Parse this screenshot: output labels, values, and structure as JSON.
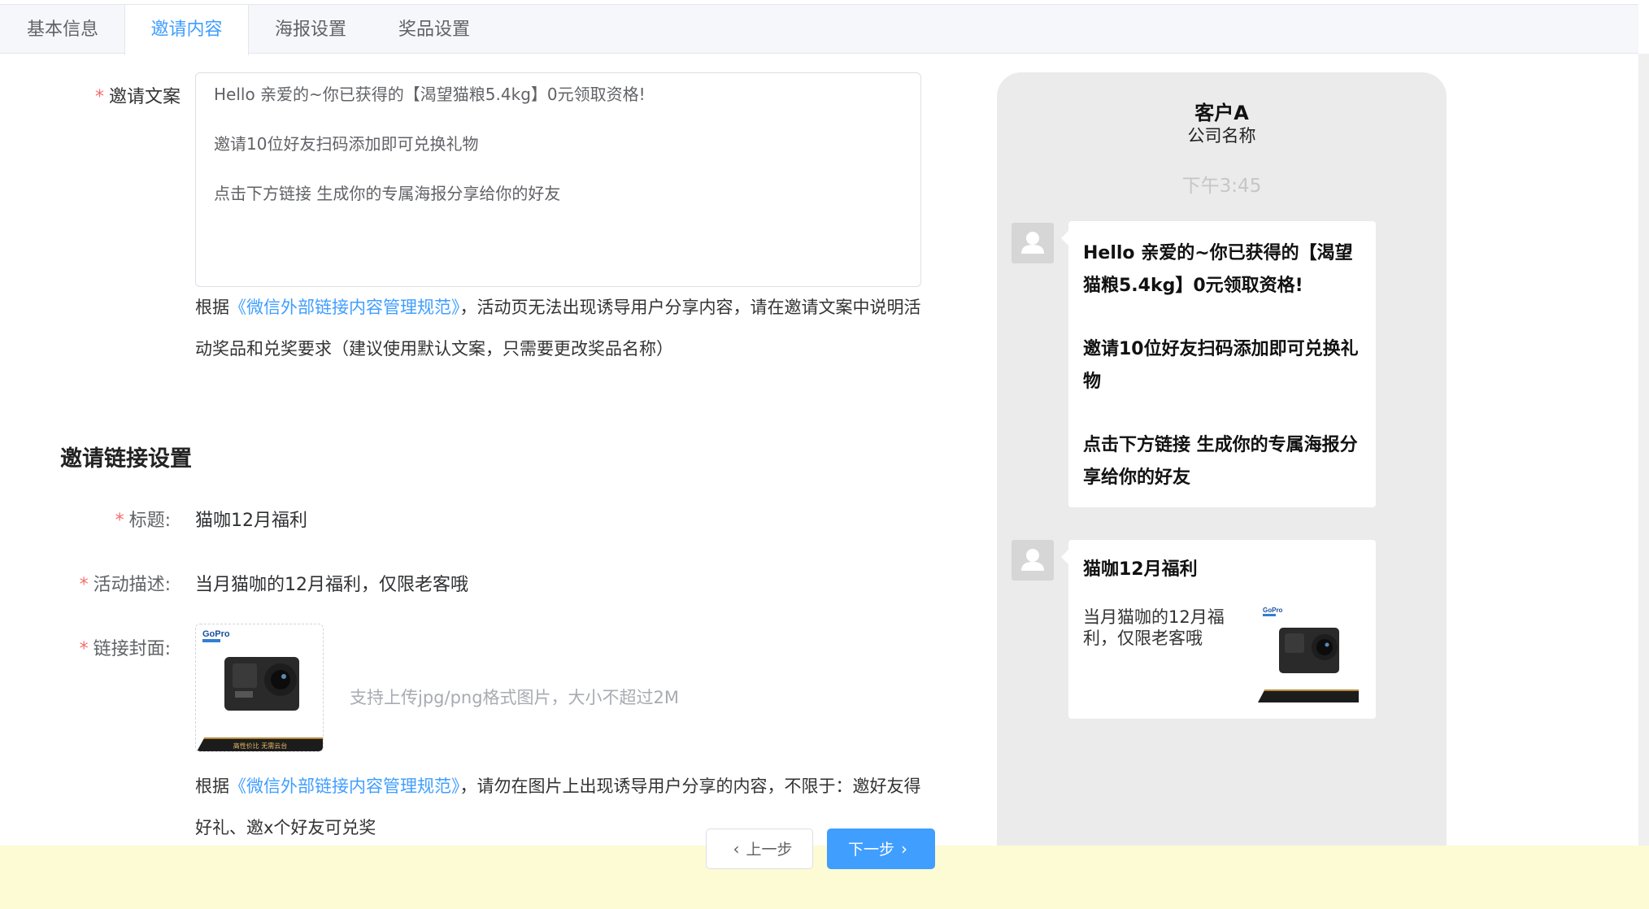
{
  "tabs": [
    {
      "label": "基本信息",
      "active": false
    },
    {
      "label": "邀请内容",
      "active": true
    },
    {
      "label": "海报设置",
      "active": false
    },
    {
      "label": "奖品设置",
      "active": false
    }
  ],
  "invite_text": {
    "label": "邀请文案",
    "lines": [
      "Hello 亲爱的~你已获得的【渴望猫粮5.4kg】0元领取资格!",
      "邀请10位好友扫码添加即可兑换礼物",
      "点击下方链接 生成你的专属海报分享给你的好友"
    ],
    "help_prefix": "根据",
    "help_link": "《微信外部链接内容管理规范》",
    "help_suffix": "，活动页无法出现诱导用户分享内容，请在邀请文案中说明活动奖品和兑奖要求（建议使用默认文案，只需要更改奖品名称）"
  },
  "link_settings": {
    "section_title": "邀请链接设置",
    "title_label": "标题:",
    "title_value": "猫咖12月福利",
    "desc_label": "活动描述:",
    "desc_value": "当月猫咖的12月福利，仅限老客哦",
    "cover_label": "链接封面:",
    "upload_tip": "支持上传jpg/png格式图片，大小不超过2M",
    "cover_brand": "GoPro",
    "cover_ribbon": "高性价比 无需云台",
    "help_prefix": "根据",
    "help_link": "《微信外部链接内容管理规范》",
    "help_suffix": "，请勿在图片上出现诱导用户分享的内容，不限于：邀好友得好礼、邀x个好友可兑奖"
  },
  "preview": {
    "customer_name": "客户A",
    "company": "公司名称",
    "time": "下午3:45",
    "message_lines": [
      "Hello 亲爱的~你已获得的【渴望猫粮5.4kg】0元领取资格!",
      "邀请10位好友扫码添加即可兑换礼物",
      "点击下方链接 生成你的专属海报分享给你的好友"
    ],
    "card_title": "猫咖12月福利",
    "card_desc": "当月猫咖的12月福利，仅限老客哦"
  },
  "footer": {
    "prev_label": "上一步",
    "next_label": "下一步"
  },
  "colors": {
    "accent": "#409eff",
    "required": "#f56c6c",
    "footer_bg": "#fdfbd4",
    "preview_bg": "#ebebeb"
  }
}
